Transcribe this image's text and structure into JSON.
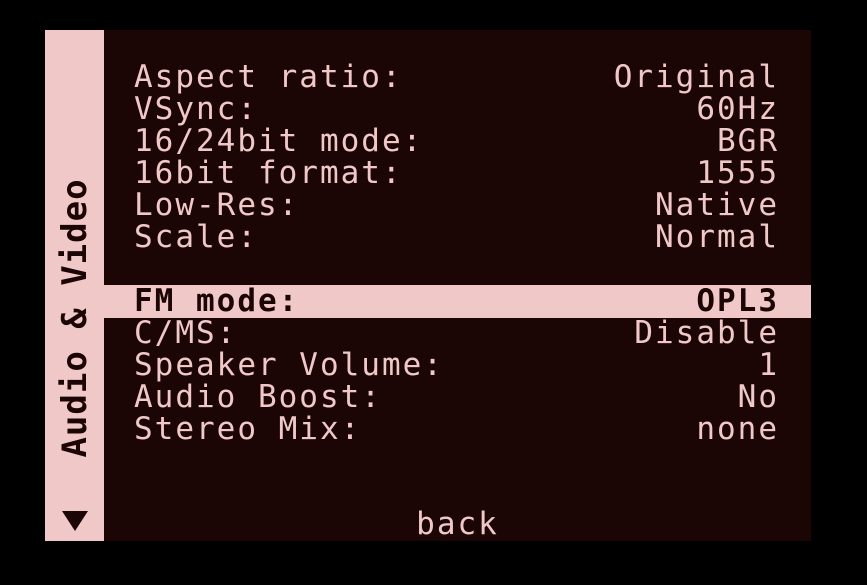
{
  "sidebar": {
    "title": "Audio & Video",
    "arrow_icon": "down-arrow-icon"
  },
  "colors": {
    "background": "#1c0505",
    "foreground": "#f0c8c8",
    "highlight": "#f0c8c8"
  },
  "video": {
    "aspect_ratio": {
      "label": "Aspect ratio:",
      "value": "Original"
    },
    "vsync": {
      "label": "VSync:",
      "value": "60Hz"
    },
    "bit_mode": {
      "label": "16/24bit mode:",
      "value": "BGR"
    },
    "bit_format": {
      "label": "16bit format:",
      "value": "1555"
    },
    "low_res": {
      "label": "Low-Res:",
      "value": "Native"
    },
    "scale": {
      "label": "Scale:",
      "value": "Normal"
    }
  },
  "audio": {
    "fm_mode": {
      "label": "FM mode:",
      "value": "OPL3"
    },
    "cms": {
      "label": "C/MS:",
      "value": "Disable"
    },
    "speaker_volume": {
      "label": "Speaker Volume:",
      "value": "1"
    },
    "audio_boost": {
      "label": "Audio Boost:",
      "value": "No"
    },
    "stereo_mix": {
      "label": "Stereo Mix:",
      "value": "none"
    }
  },
  "selected_item": "fm_mode",
  "back_label": "back"
}
